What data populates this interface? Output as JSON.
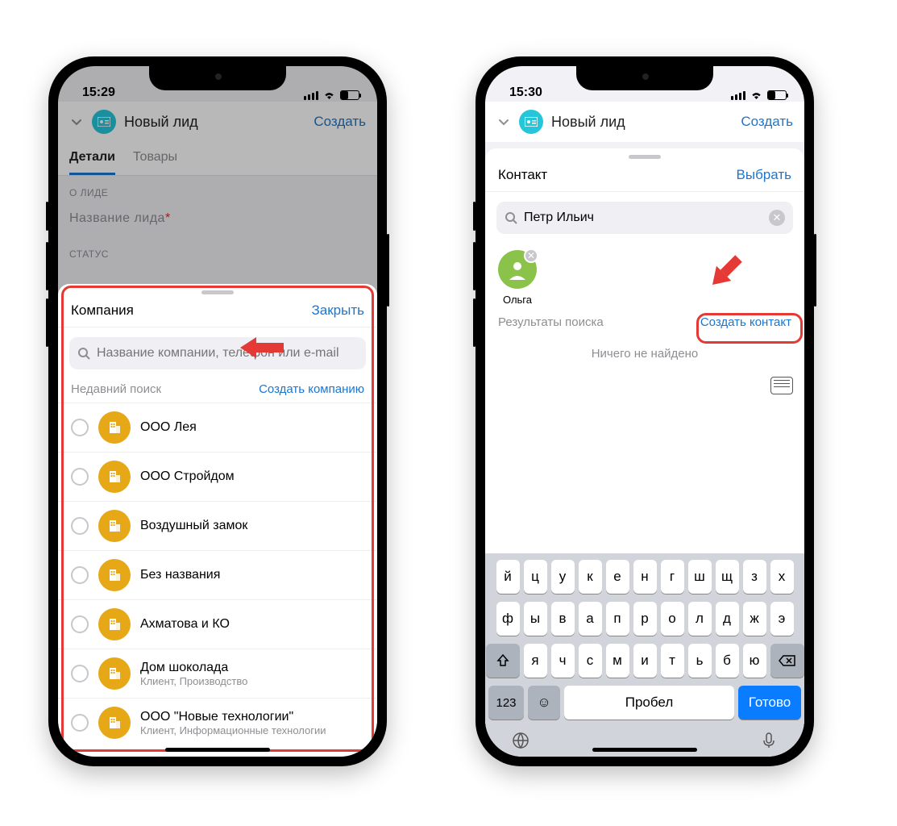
{
  "left": {
    "time": "15:29",
    "header_title": "Новый лид",
    "header_action": "Создать",
    "tabs": [
      "Детали",
      "Товары"
    ],
    "section_label": "О ЛИДЕ",
    "field_lead_name": "Название лида",
    "status_label": "СТАТУС",
    "sheet_title": "Компания",
    "sheet_close": "Закрыть",
    "search_placeholder": "Название компании, телефон или e-mail",
    "recent_label": "Недавний поиск",
    "create_company": "Создать компанию",
    "companies": [
      {
        "name": "ООО Лея",
        "sub": ""
      },
      {
        "name": "ООО Стройдом",
        "sub": ""
      },
      {
        "name": "Воздушный замок",
        "sub": ""
      },
      {
        "name": "Без названия",
        "sub": ""
      },
      {
        "name": "Ахматова и КО",
        "sub": ""
      },
      {
        "name": "Дом шоколада",
        "sub": "Клиент, Производство"
      },
      {
        "name": "ООО \"Новые технологии\"",
        "sub": "Клиент, Информационные технологии"
      }
    ]
  },
  "right": {
    "time": "15:30",
    "header_title": "Новый лид",
    "header_action": "Создать",
    "sheet_title": "Контакт",
    "sheet_select": "Выбрать",
    "search_value": "Петр Ильич",
    "chip_name": "Ольга",
    "results_label": "Результаты поиска",
    "create_contact": "Создать контакт",
    "empty_text": "Ничего не найдено",
    "kb_rows": [
      [
        "й",
        "ц",
        "у",
        "к",
        "е",
        "н",
        "г",
        "ш",
        "щ",
        "з",
        "х"
      ],
      [
        "ф",
        "ы",
        "в",
        "а",
        "п",
        "р",
        "о",
        "л",
        "д",
        "ж",
        "э"
      ],
      [
        "я",
        "ч",
        "с",
        "м",
        "и",
        "т",
        "ь",
        "б",
        "ю"
      ]
    ],
    "kb_123": "123",
    "kb_space": "Пробел",
    "kb_done": "Готово"
  }
}
